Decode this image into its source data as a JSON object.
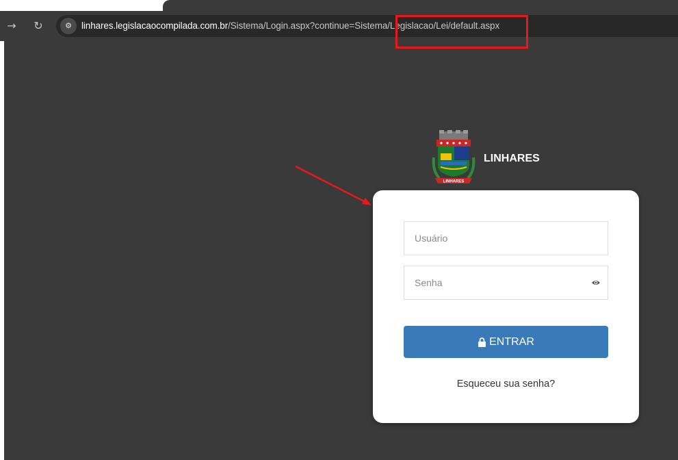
{
  "browser": {
    "back_icon": "arrow-right",
    "reload_icon": "reload",
    "site_info_icon": "tune",
    "url": {
      "host": "linhares.legislacaocompilada.com.br",
      "path": "/Sistema/Login.aspx?continue=Sistema/Legislacao/Lei/default.aspx"
    }
  },
  "header": {
    "brand": "LINHARES",
    "logo_ribbon": "LINHARES"
  },
  "login": {
    "username_placeholder": "Usuário",
    "password_placeholder": "Senha",
    "submit_label": "ENTRAR",
    "forgot_label": "Esqueceu sua senha?"
  },
  "colors": {
    "page_bg": "#3a3a3a",
    "button": "#3a7ab8",
    "annotation": "#e8191a"
  }
}
